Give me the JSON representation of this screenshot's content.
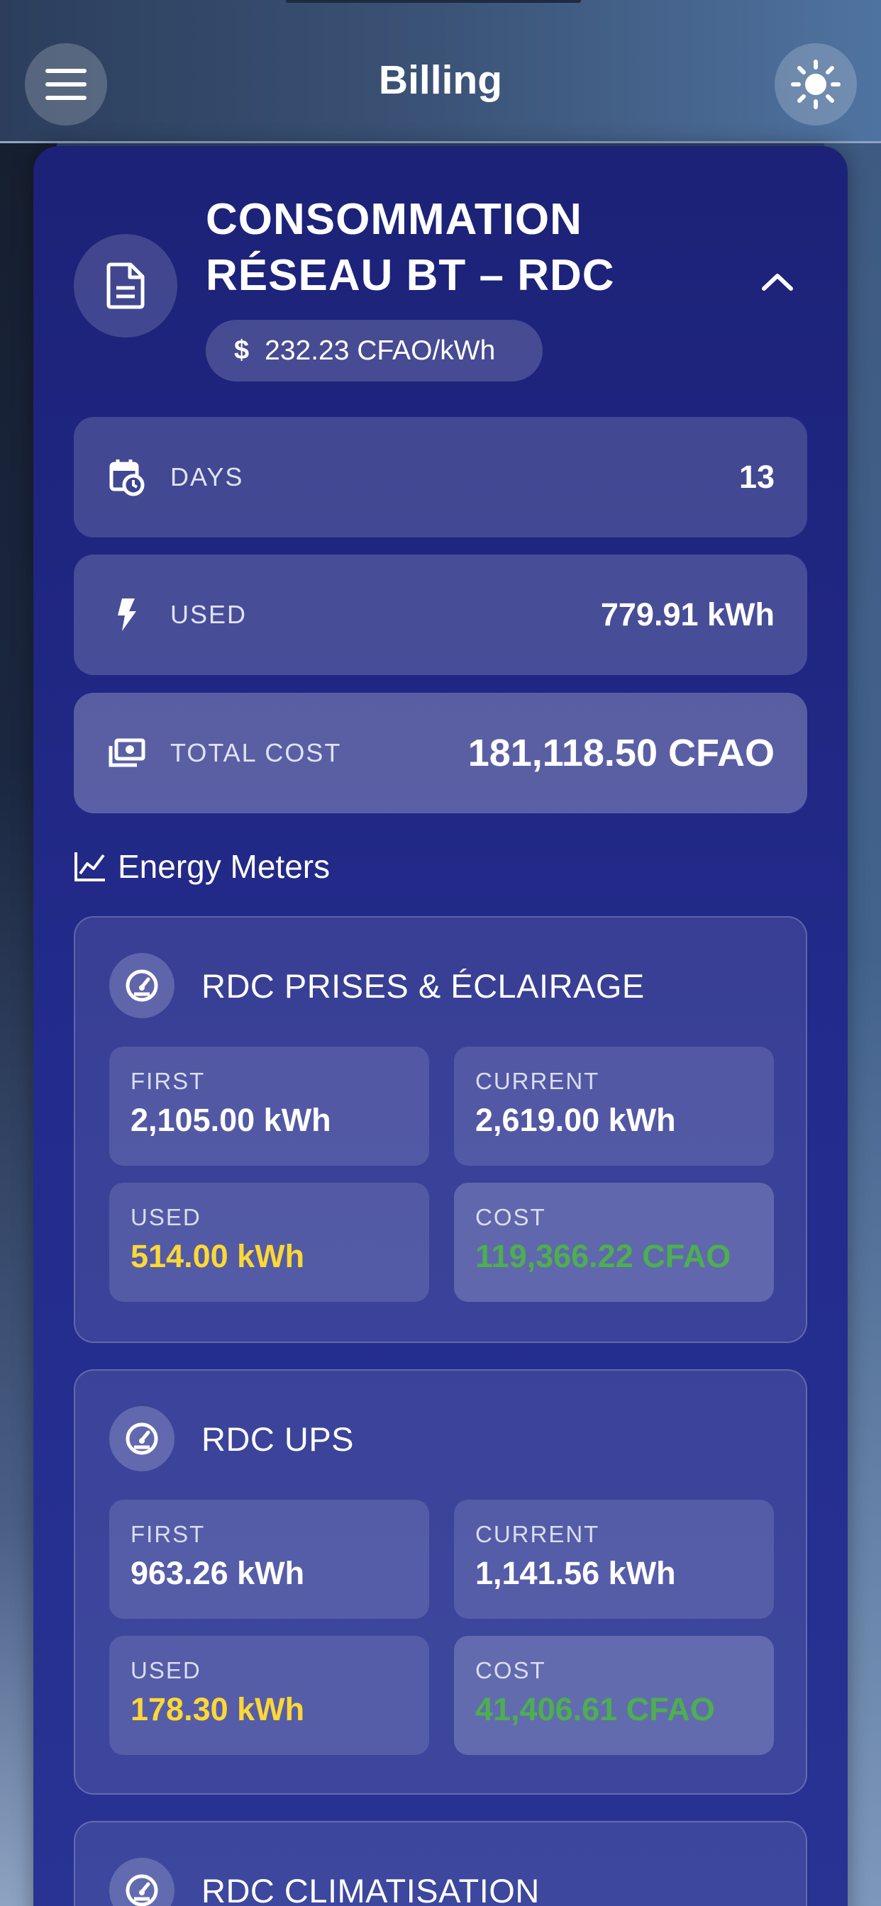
{
  "appbar": {
    "title": "Billing"
  },
  "summary": {
    "title_line1": "CONSOMMATION",
    "title_line2": "RÉSEAU BT – RDC",
    "rate": "232.23 CFAO/kWh",
    "rate_symbol": "$",
    "days_label": "DAYS",
    "days_value": "13",
    "used_label": "USED",
    "used_value": "779.91 kWh",
    "total_label": "TOTAL COST",
    "total_value": "181,118.50 CFAO"
  },
  "section": {
    "title": "Energy Meters"
  },
  "meters": [
    {
      "name": "RDC PRISES & ÉCLAIRAGE",
      "first_label": "FIRST",
      "first_value": "2,105.00 kWh",
      "current_label": "CURRENT",
      "current_value": "2,619.00 kWh",
      "used_label": "USED",
      "used_value": "514.00 kWh",
      "cost_label": "COST",
      "cost_value": "119,366.22 CFAO"
    },
    {
      "name": "RDC UPS",
      "first_label": "FIRST",
      "first_value": "963.26 kWh",
      "current_label": "CURRENT",
      "current_value": "1,141.56 kWh",
      "used_label": "USED",
      "used_value": "178.30 kWh",
      "cost_label": "COST",
      "cost_value": "41,406.61 CFAO"
    },
    {
      "name": "RDC CLIMATISATION"
    }
  ],
  "colors": {
    "used_value": "#fdd835",
    "cost_value": "#4caf50",
    "card_background": "#232b8c"
  },
  "icons": {
    "menu": "menu-icon",
    "theme": "sun-icon",
    "document": "document-icon",
    "collapse": "chevron-up-icon",
    "days": "calendar-clock-icon",
    "used": "bolt-icon",
    "total": "cash-icon",
    "section": "line-chart-icon",
    "meter": "gauge-icon"
  }
}
